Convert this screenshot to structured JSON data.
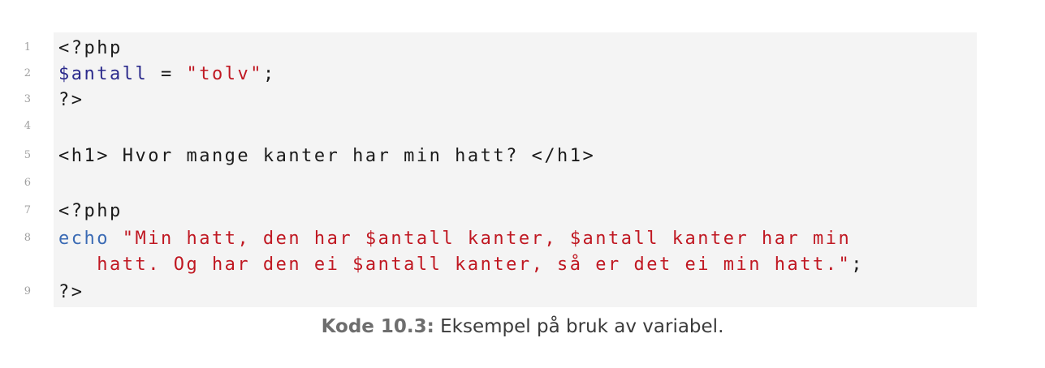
{
  "code": {
    "lines": [
      {
        "number": "1",
        "parts": [
          "<?php"
        ]
      },
      {
        "number": "2",
        "parts": [
          "$antall",
          " = ",
          "\"tolv\"",
          ";"
        ]
      },
      {
        "number": "3",
        "parts": [
          "?>"
        ]
      },
      {
        "number": "4",
        "parts": [
          ""
        ]
      },
      {
        "number": "5",
        "parts": [
          "<h1> Hvor mange kanter har min hatt? </h1>"
        ]
      },
      {
        "number": "6",
        "parts": [
          ""
        ]
      },
      {
        "number": "7",
        "parts": [
          "<?php"
        ]
      },
      {
        "number": "8",
        "parts": [
          "echo",
          " ",
          "\"Min hatt, den har $antall kanter, $antall kanter har min"
        ]
      },
      {
        "number": "",
        "parts": [
          "   hatt. Og har den ei $antall kanter, så er det ei min hatt.\"",
          ";"
        ]
      },
      {
        "number": "9",
        "parts": [
          "?>"
        ]
      }
    ]
  },
  "caption": {
    "label": "Kode 10.3:",
    "text": " Eksempel på bruk av variabel."
  },
  "colors": {
    "background": "#f4f4f4",
    "variable": "#2b2a8c",
    "string": "#c01822",
    "keyword": "#3a6ab4",
    "line_number": "#a0a0a0"
  }
}
